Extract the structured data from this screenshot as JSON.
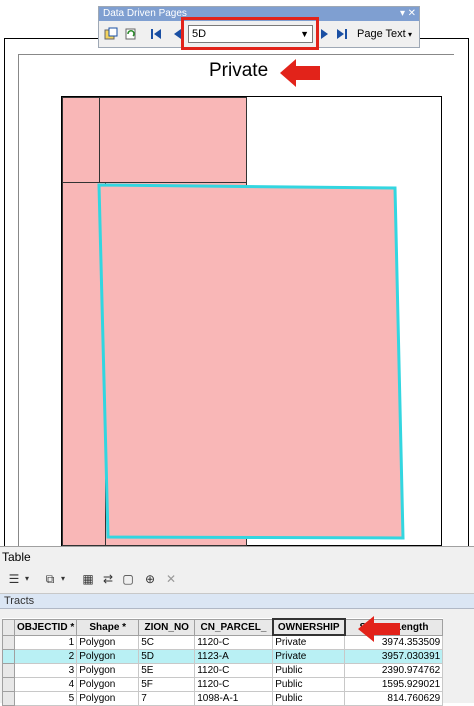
{
  "ddp_toolbar": {
    "title": "Data Driven Pages",
    "current_page": "5D",
    "page_text_label": "Page Text",
    "first_icon": "first-page-icon",
    "prev_icon": "previous-page-icon",
    "next_icon": "next-page-icon",
    "last_icon": "last-page-icon"
  },
  "layout": {
    "dynamic_title": "Private",
    "parcel_fill": "#f9b7b7",
    "selected_outline": "#33d6e0"
  },
  "annotation_color": "#e2231a",
  "table": {
    "window_title": "Table",
    "tab_label": "Tracts",
    "columns": [
      "OBJECTID *",
      "Shape *",
      "ZION_NO",
      "CN_PARCEL_",
      "OWNERSHIP",
      "Shape_Length"
    ],
    "rows": [
      {
        "objectid": "1",
        "shape": "Polygon",
        "zion_no": "5C",
        "cn_parcel": "1120-C",
        "ownership": "Private",
        "shape_length": "3974.353509",
        "selected": false
      },
      {
        "objectid": "2",
        "shape": "Polygon",
        "zion_no": "5D",
        "cn_parcel": "1123-A",
        "ownership": "Private",
        "shape_length": "3957.030391",
        "selected": true
      },
      {
        "objectid": "3",
        "shape": "Polygon",
        "zion_no": "5E",
        "cn_parcel": "1120-C",
        "ownership": "Public",
        "shape_length": "2390.974762",
        "selected": false
      },
      {
        "objectid": "4",
        "shape": "Polygon",
        "zion_no": "5F",
        "cn_parcel": "1120-C",
        "ownership": "Public",
        "shape_length": "1595.929021",
        "selected": false
      },
      {
        "objectid": "5",
        "shape": "Polygon",
        "zion_no": "7",
        "cn_parcel": "1098-A-1",
        "ownership": "Public",
        "shape_length": "814.760629",
        "selected": false
      }
    ]
  }
}
